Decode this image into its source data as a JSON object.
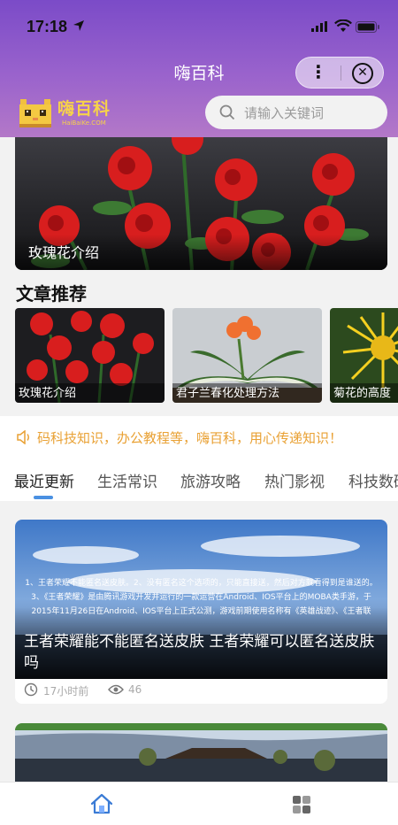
{
  "status_bar": {
    "time": "17:18"
  },
  "nav": {
    "title": "嗨百科"
  },
  "logo": {
    "text": "嗨百科",
    "sub": "HaiBaiKe.COM"
  },
  "search": {
    "placeholder": "请输入关键词"
  },
  "banner": {
    "caption": "玫瑰花介绍"
  },
  "recommend": {
    "title": "文章推荐",
    "items": [
      {
        "label": "玫瑰花介绍"
      },
      {
        "label": "君子兰春化处理方法"
      },
      {
        "label": "菊花的高度"
      }
    ]
  },
  "notice": {
    "text": "码科技知识，办公教程等，嗨百科，用心传递知识！"
  },
  "tabs": [
    {
      "label": "最近更新",
      "active": true
    },
    {
      "label": "生活常识"
    },
    {
      "label": "旅游攻略"
    },
    {
      "label": "热门影视"
    },
    {
      "label": "科技数码"
    }
  ],
  "articles": [
    {
      "title": "王者荣耀能不能匿名送皮肤 王者荣耀可以匿名送皮肤吗",
      "image_text": "1、王者荣耀不能匿名送皮肤。2、没有匿名这个选项的，只能直接送，然后对方就看得到是谁送的。3、《王者荣耀》是由腾讯游戏开发并运行的一款运营在Android、IOS平台上的MOBA类手游，于2015年11月26日在Android、IOS平台上正式公测，游戏前期使用名称有《英雄战迹》、《王者联盟》。",
      "time": "17小时前",
      "views": "46"
    }
  ],
  "colors": {
    "header_top": "#7b4bc8",
    "accent_blue": "#4a90e2",
    "notice": "#e9a134",
    "logo": "#f7d24a"
  }
}
